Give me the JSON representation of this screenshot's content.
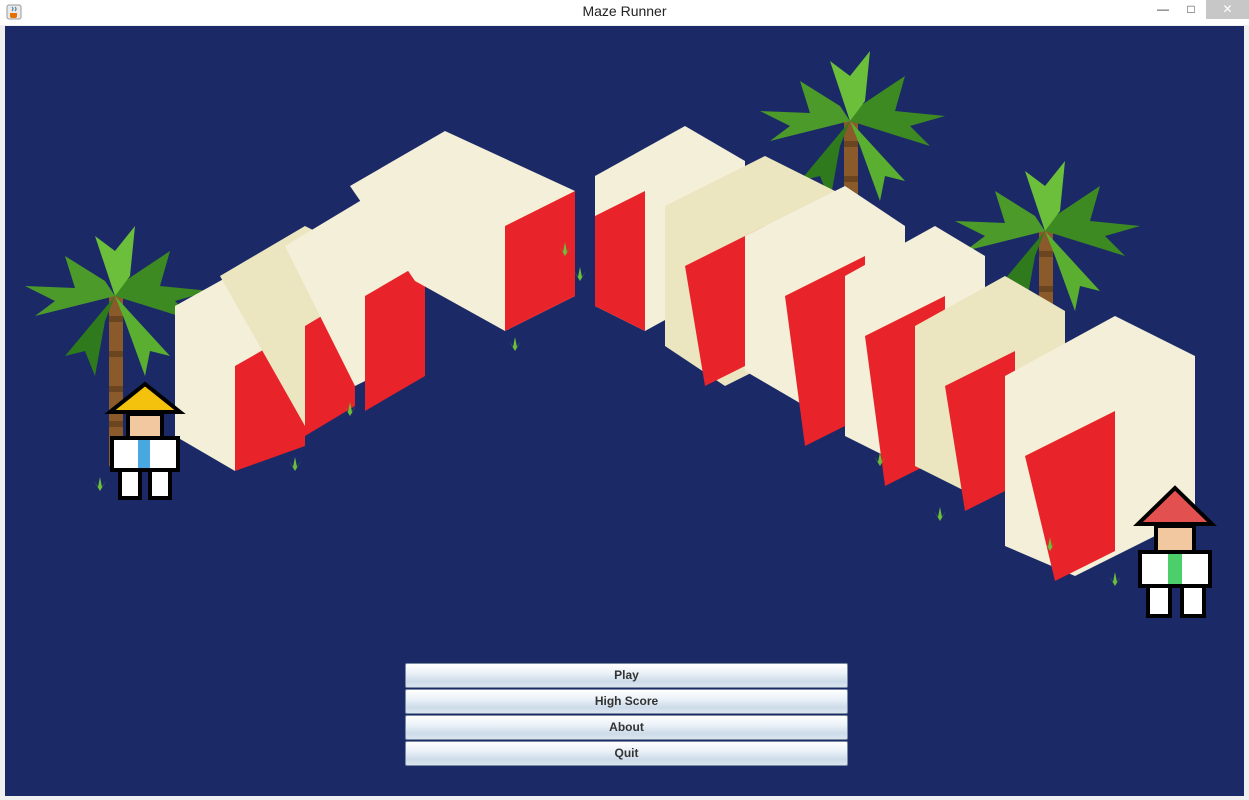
{
  "window": {
    "title": "Maze Runner",
    "app_icon": "java-cup-icon",
    "controls": {
      "minimize": "—",
      "maximize": "□",
      "close": "✕"
    }
  },
  "game": {
    "logo_text": "MAZE RUNNER",
    "background_color": "#1b2a66",
    "letter_face_color": "#f3efd8",
    "letter_side_color": "#e8232a",
    "characters": [
      "player-yellow-hat",
      "player-red-hat"
    ]
  },
  "menu": {
    "play": "Play",
    "high_score": "High Score",
    "about": "About",
    "quit": "Quit"
  }
}
